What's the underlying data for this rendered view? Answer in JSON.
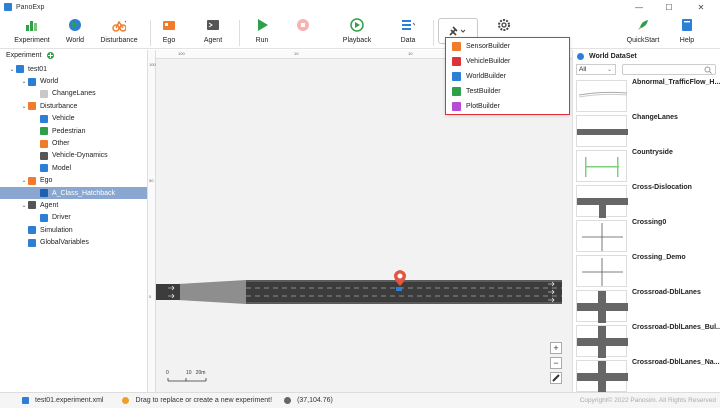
{
  "app": {
    "title": "PanoExp"
  },
  "toolbar": {
    "experiment": "Experiment",
    "world": "World",
    "disturbance": "Disturbance",
    "ego": "Ego",
    "agent": "Agent",
    "run": "Run",
    "playback": "Playback",
    "data": "Data",
    "quickstart": "QuickStart",
    "help": "Help"
  },
  "builder_menu": {
    "items": [
      {
        "label": "SensorBuilder",
        "color": "#f07c2b"
      },
      {
        "label": "VehicleBuilder",
        "color": "#e0303a"
      },
      {
        "label": "WorldBuilder",
        "color": "#2d7fd6"
      },
      {
        "label": "TestBuilder",
        "color": "#2fa04a"
      },
      {
        "label": "PlotBuilder",
        "color": "#b84bd6"
      }
    ]
  },
  "sidebar": {
    "header": "Experiment",
    "tree": [
      {
        "label": "test01",
        "level": 0,
        "icon": "folder-icon",
        "color": "#2d7fd6",
        "chev": "⌄"
      },
      {
        "label": "World",
        "level": 1,
        "icon": "globe-icon",
        "color": "#2d7fd6",
        "chev": "⌄"
      },
      {
        "label": "ChangeLanes",
        "level": 2,
        "icon": "map-icon",
        "color": "#c8c8c8",
        "chev": ""
      },
      {
        "label": "Disturbance",
        "level": 1,
        "icon": "disturbance-icon",
        "color": "#f07c2b",
        "chev": "⌄"
      },
      {
        "label": "Vehicle",
        "level": 2,
        "icon": "vehicle-icon",
        "color": "#2d7fd6",
        "chev": ""
      },
      {
        "label": "Pedestrian",
        "level": 2,
        "icon": "pedestrian-icon",
        "color": "#2fa04a",
        "chev": ""
      },
      {
        "label": "Other",
        "level": 2,
        "icon": "other-icon",
        "color": "#f07c2b",
        "chev": ""
      },
      {
        "label": "Vehicle-Dynamics",
        "level": 2,
        "icon": "dynamics-icon",
        "color": "#555555",
        "chev": ""
      },
      {
        "label": "Model",
        "level": 2,
        "icon": "model-icon",
        "color": "#2d7fd6",
        "chev": ""
      },
      {
        "label": "Ego",
        "level": 1,
        "icon": "ego-icon",
        "color": "#f07c2b",
        "chev": "⌄"
      },
      {
        "label": "A_Class_Hatchback",
        "level": 2,
        "icon": "car-icon",
        "color": "#1f5fb0",
        "chev": "",
        "selected": true
      },
      {
        "label": "Agent",
        "level": 1,
        "icon": "agent-icon",
        "color": "#555555",
        "chev": "⌄"
      },
      {
        "label": "Driver",
        "level": 2,
        "icon": "driver-icon",
        "color": "#2d7fd6",
        "chev": ""
      },
      {
        "label": "Simulation",
        "level": 1,
        "icon": "simulation-icon",
        "color": "#2d7fd6",
        "chev": ""
      },
      {
        "label": "GlobalVariables",
        "level": 1,
        "icon": "variables-icon",
        "color": "#2d7fd6",
        "chev": ""
      }
    ]
  },
  "map": {
    "ruler_top": [
      "100",
      "10",
      "10"
    ],
    "ruler_left": [
      "100",
      "50",
      "0"
    ],
    "scale_label": "10   20m",
    "scale_zero": "0"
  },
  "dataset": {
    "title": "World DataSet",
    "filter_value": "All",
    "items": [
      "Abnormal_TrafficFlow_H...",
      "ChangeLanes",
      "Countryside",
      "Cross-Dislocation",
      "Crossing0",
      "Crossing_Demo",
      "Crossroad-DblLanes",
      "Crossroad-DblLanes_Bul...",
      "Crossroad-DblLanes_Na..."
    ]
  },
  "status": {
    "file": "test01.experiment.xml",
    "hint": "Drag to replace or create a new experiment!",
    "coords": "(37,104.76)",
    "copyright": "Copyright© 2022 Panosim. All Rights Reserved"
  }
}
